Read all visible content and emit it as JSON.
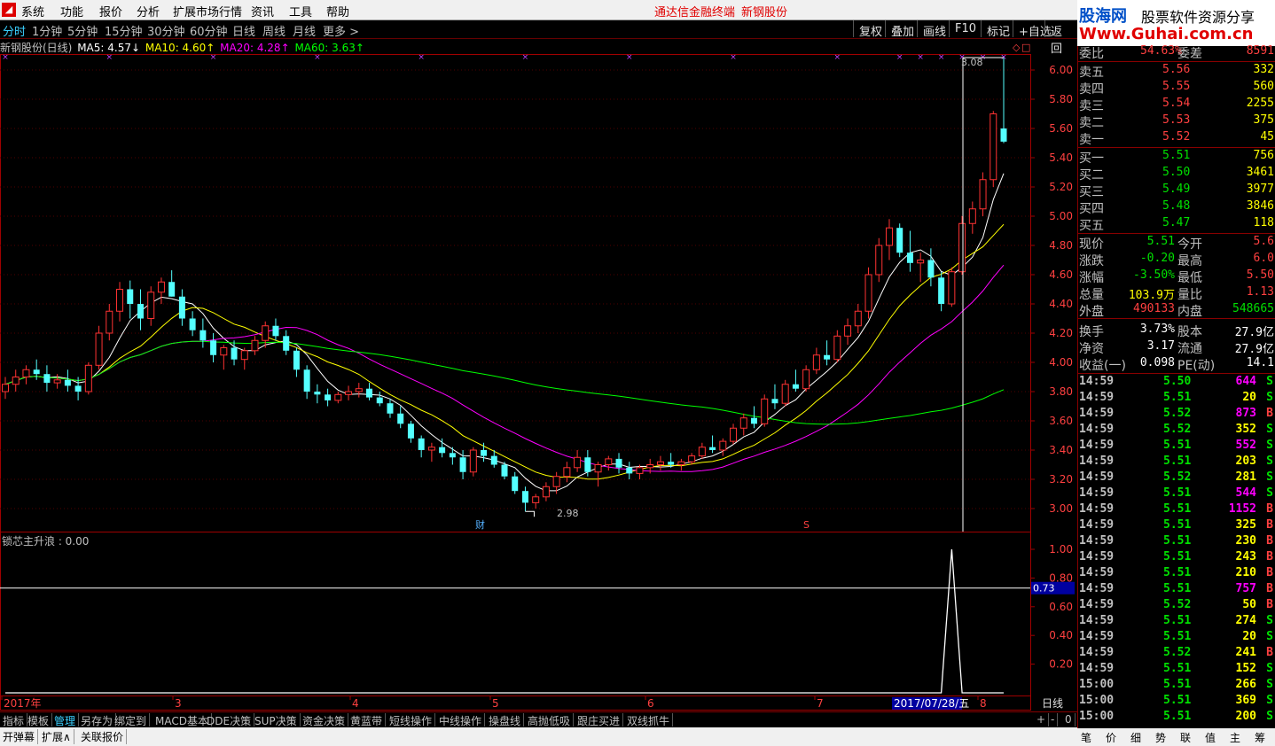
{
  "menu": {
    "items": [
      "系统",
      "功能",
      "报价",
      "分析",
      "扩展市场行情",
      "资讯",
      "工具",
      "帮助"
    ],
    "title1": "通达信金融终端",
    "title2": "新钢股份"
  },
  "brand": {
    "logo": "股海网",
    "slogan": "股票软件资源分享",
    "url": "Www.Guhai.com.cn"
  },
  "periods": [
    "分时",
    "1分钟",
    "5分钟",
    "15分钟",
    "30分钟",
    "60分钟",
    "日线",
    "周线",
    "月线",
    "更多 >"
  ],
  "right_buttons": [
    "复权",
    "叠加",
    "画线",
    "F10",
    "标记",
    "+自选",
    "返回"
  ],
  "ma": {
    "name": "新钢股份(日线)",
    "ma5": "MA5: 4.57↓",
    "ma10": "MA10: 4.60↑",
    "ma20": "MA20: 4.28↑",
    "ma60": "MA60: 3.63↑",
    "colors": {
      "ma5": "#ffffff",
      "ma10": "#ffff00",
      "ma20": "#ff00ff",
      "ma60": "#00ff00"
    }
  },
  "price_axis": [
    "6.00",
    "5.80",
    "5.60",
    "5.40",
    "5.20",
    "5.00",
    "4.80",
    "4.60",
    "4.40",
    "4.20",
    "4.00",
    "3.80",
    "3.60",
    "3.40",
    "3.20",
    "3.00"
  ],
  "ind_axis": [
    "1.00",
    "0.80",
    "0.60",
    "0.40",
    "0.20"
  ],
  "ind_current": "0.73",
  "annotations": {
    "high": "3.08",
    "low": "2.98",
    "cai": "财",
    "s": "S"
  },
  "indicator_label": "锁芯主升浪 : 0.00",
  "x_axis": {
    "year": "2017年",
    "m3": "3",
    "m4": "4",
    "m5": "5",
    "m6": "6",
    "m7": "7",
    "date": "2017/07/28/五",
    "m8": "8",
    "period": "日线"
  },
  "bottom_tabs": [
    "指标",
    "模板",
    "管理",
    "另存为",
    "绑定到",
    "MACD基本",
    "DDE决策",
    "SUP决策",
    "资金决策",
    "黄蓝带",
    "短线操作",
    "中线操作",
    "操盘线",
    "高抛低吸",
    "跟庄买进",
    "双线抓牛"
  ],
  "bottom_tabs2": [
    "开弹幕",
    "扩展∧",
    "关联报价"
  ],
  "zoom": [
    "+",
    "-",
    "0"
  ],
  "quote": {
    "wb": {
      "l1": "委比",
      "v1": "54.63%",
      "l2": "委差",
      "v2": "8591"
    },
    "sell": [
      [
        "卖五",
        "5.56",
        "332"
      ],
      [
        "卖四",
        "5.55",
        "560"
      ],
      [
        "卖三",
        "5.54",
        "2255"
      ],
      [
        "卖二",
        "5.53",
        "375"
      ],
      [
        "卖一",
        "5.52",
        "45"
      ]
    ],
    "buy": [
      [
        "买一",
        "5.51",
        "756"
      ],
      [
        "买二",
        "5.50",
        "3461"
      ],
      [
        "买三",
        "5.49",
        "3977"
      ],
      [
        "买四",
        "5.48",
        "3846"
      ],
      [
        "买五",
        "5.47",
        "118"
      ]
    ],
    "stats": [
      [
        "现价",
        "5.51",
        "今开",
        "5.6"
      ],
      [
        "涨跌",
        "-0.20",
        "最高",
        "6.0"
      ],
      [
        "涨幅",
        "-3.50%",
        "最低",
        "5.50"
      ],
      [
        "总量",
        "103.9万",
        "量比",
        "1.13"
      ],
      [
        "外盘",
        "490133",
        "内盘",
        "548665"
      ],
      [
        "换手",
        "3.73%",
        "股本",
        "27.9亿"
      ],
      [
        "净资",
        "3.17",
        "流通",
        "27.9亿"
      ],
      [
        "收益(一)",
        "0.098",
        "PE(动)",
        "14.1"
      ]
    ],
    "ticks": [
      [
        "14:59",
        "5.50",
        "644",
        "S"
      ],
      [
        "14:59",
        "5.51",
        "20",
        "S"
      ],
      [
        "14:59",
        "5.52",
        "873",
        "B"
      ],
      [
        "14:59",
        "5.52",
        "352",
        "S"
      ],
      [
        "14:59",
        "5.51",
        "552",
        "S"
      ],
      [
        "14:59",
        "5.51",
        "203",
        "S"
      ],
      [
        "14:59",
        "5.52",
        "281",
        "S"
      ],
      [
        "14:59",
        "5.51",
        "544",
        "S"
      ],
      [
        "14:59",
        "5.51",
        "1152",
        "B"
      ],
      [
        "14:59",
        "5.51",
        "325",
        "B"
      ],
      [
        "14:59",
        "5.51",
        "230",
        "B"
      ],
      [
        "14:59",
        "5.51",
        "243",
        "B"
      ],
      [
        "14:59",
        "5.51",
        "210",
        "B"
      ],
      [
        "14:59",
        "5.51",
        "757",
        "B"
      ],
      [
        "14:59",
        "5.52",
        "50",
        "B"
      ],
      [
        "14:59",
        "5.51",
        "274",
        "S"
      ],
      [
        "14:59",
        "5.51",
        "20",
        "S"
      ],
      [
        "14:59",
        "5.52",
        "241",
        "B"
      ],
      [
        "14:59",
        "5.51",
        "152",
        "S"
      ],
      [
        "15:00",
        "5.51",
        "266",
        "S"
      ],
      [
        "15:00",
        "5.51",
        "369",
        "S"
      ],
      [
        "15:00",
        "5.51",
        "200",
        "S"
      ]
    ],
    "tabs": [
      "笔",
      "价",
      "细",
      "势",
      "联",
      "值",
      "主",
      "筹"
    ]
  },
  "chart_data": {
    "type": "candlestick",
    "title": "新钢股份(日线)",
    "ylim": [
      2.9,
      6.1
    ],
    "candles": [
      [
        3.8,
        3.9,
        3.75,
        3.85
      ],
      [
        3.85,
        3.95,
        3.8,
        3.9
      ],
      [
        3.9,
        3.98,
        3.85,
        3.95
      ],
      [
        3.95,
        4.02,
        3.88,
        3.92
      ],
      [
        3.92,
        3.98,
        3.8,
        3.86
      ],
      [
        3.86,
        3.92,
        3.82,
        3.88
      ],
      [
        3.88,
        3.95,
        3.8,
        3.84
      ],
      [
        3.84,
        3.9,
        3.74,
        3.8
      ],
      [
        3.8,
        4.0,
        3.78,
        3.98
      ],
      [
        3.98,
        4.25,
        3.95,
        4.2
      ],
      [
        4.2,
        4.4,
        4.15,
        4.35
      ],
      [
        4.35,
        4.55,
        4.28,
        4.5
      ],
      [
        4.5,
        4.56,
        4.3,
        4.4
      ],
      [
        4.4,
        4.5,
        4.22,
        4.3
      ],
      [
        4.3,
        4.52,
        4.25,
        4.48
      ],
      [
        4.48,
        4.58,
        4.4,
        4.55
      ],
      [
        4.55,
        4.63,
        4.45,
        4.45
      ],
      [
        4.45,
        4.5,
        4.25,
        4.3
      ],
      [
        4.3,
        4.35,
        4.18,
        4.22
      ],
      [
        4.22,
        4.3,
        4.1,
        4.15
      ],
      [
        4.15,
        4.2,
        4.0,
        4.05
      ],
      [
        4.05,
        4.12,
        3.95,
        4.1
      ],
      [
        4.1,
        4.15,
        3.98,
        4.02
      ],
      [
        4.02,
        4.1,
        3.95,
        4.08
      ],
      [
        4.08,
        4.18,
        4.05,
        4.15
      ],
      [
        4.15,
        4.28,
        4.1,
        4.25
      ],
      [
        4.25,
        4.3,
        4.15,
        4.18
      ],
      [
        4.18,
        4.22,
        4.05,
        4.08
      ],
      [
        4.08,
        4.1,
        3.9,
        3.95
      ],
      [
        3.95,
        3.98,
        3.75,
        3.8
      ],
      [
        3.8,
        3.85,
        3.72,
        3.78
      ],
      [
        3.78,
        3.82,
        3.7,
        3.74
      ],
      [
        3.74,
        3.8,
        3.72,
        3.78
      ],
      [
        3.78,
        3.84,
        3.74,
        3.8
      ],
      [
        3.8,
        3.86,
        3.76,
        3.82
      ],
      [
        3.82,
        3.86,
        3.74,
        3.76
      ],
      [
        3.76,
        3.8,
        3.7,
        3.72
      ],
      [
        3.72,
        3.75,
        3.62,
        3.65
      ],
      [
        3.65,
        3.7,
        3.55,
        3.58
      ],
      [
        3.58,
        3.6,
        3.45,
        3.48
      ],
      [
        3.48,
        3.5,
        3.35,
        3.4
      ],
      [
        3.4,
        3.45,
        3.32,
        3.42
      ],
      [
        3.42,
        3.48,
        3.35,
        3.38
      ],
      [
        3.38,
        3.42,
        3.3,
        3.35
      ],
      [
        3.35,
        3.4,
        3.2,
        3.25
      ],
      [
        3.25,
        3.42,
        3.22,
        3.4
      ],
      [
        3.4,
        3.45,
        3.32,
        3.36
      ],
      [
        3.36,
        3.4,
        3.28,
        3.3
      ],
      [
        3.3,
        3.32,
        3.2,
        3.22
      ],
      [
        3.22,
        3.25,
        3.1,
        3.12
      ],
      [
        3.12,
        3.15,
        2.98,
        3.04
      ],
      [
        3.04,
        3.1,
        3.0,
        3.08
      ],
      [
        3.08,
        3.18,
        3.05,
        3.15
      ],
      [
        3.15,
        3.25,
        3.1,
        3.22
      ],
      [
        3.22,
        3.32,
        3.18,
        3.28
      ],
      [
        3.28,
        3.4,
        3.25,
        3.35
      ],
      [
        3.35,
        3.4,
        3.22,
        3.25
      ],
      [
        3.25,
        3.32,
        3.15,
        3.3
      ],
      [
        3.3,
        3.36,
        3.26,
        3.34
      ],
      [
        3.34,
        3.38,
        3.24,
        3.28
      ],
      [
        3.28,
        3.32,
        3.2,
        3.24
      ],
      [
        3.24,
        3.3,
        3.2,
        3.28
      ],
      [
        3.28,
        3.34,
        3.24,
        3.3
      ],
      [
        3.3,
        3.36,
        3.26,
        3.32
      ],
      [
        3.32,
        3.38,
        3.28,
        3.3
      ],
      [
        3.3,
        3.34,
        3.26,
        3.32
      ],
      [
        3.32,
        3.38,
        3.3,
        3.36
      ],
      [
        3.36,
        3.45,
        3.34,
        3.42
      ],
      [
        3.42,
        3.5,
        3.38,
        3.4
      ],
      [
        3.4,
        3.48,
        3.36,
        3.46
      ],
      [
        3.46,
        3.58,
        3.44,
        3.55
      ],
      [
        3.55,
        3.65,
        3.5,
        3.62
      ],
      [
        3.62,
        3.7,
        3.55,
        3.58
      ],
      [
        3.58,
        3.78,
        3.56,
        3.75
      ],
      [
        3.75,
        3.85,
        3.68,
        3.72
      ],
      [
        3.72,
        3.88,
        3.7,
        3.85
      ],
      [
        3.85,
        3.95,
        3.8,
        3.82
      ],
      [
        3.82,
        3.98,
        3.8,
        3.95
      ],
      [
        3.95,
        4.1,
        3.92,
        4.05
      ],
      [
        4.05,
        4.15,
        3.98,
        4.02
      ],
      [
        4.02,
        4.22,
        4.0,
        4.18
      ],
      [
        4.18,
        4.3,
        4.12,
        4.25
      ],
      [
        4.25,
        4.4,
        4.2,
        4.35
      ],
      [
        4.35,
        4.65,
        4.3,
        4.6
      ],
      [
        4.6,
        4.85,
        4.55,
        4.8
      ],
      [
        4.8,
        4.98,
        4.7,
        4.92
      ],
      [
        4.92,
        4.95,
        4.72,
        4.75
      ],
      [
        4.75,
        4.9,
        4.62,
        4.68
      ],
      [
        4.68,
        4.75,
        4.55,
        4.7
      ],
      [
        4.7,
        4.78,
        4.52,
        4.58
      ],
      [
        4.58,
        4.62,
        4.35,
        4.4
      ],
      [
        4.4,
        4.65,
        4.38,
        4.62
      ],
      [
        4.62,
        5.0,
        4.6,
        4.95
      ],
      [
        4.95,
        5.1,
        4.88,
        5.05
      ],
      [
        5.05,
        5.3,
        5.0,
        5.25
      ],
      [
        5.25,
        5.72,
        5.2,
        5.7
      ],
      [
        5.6,
        6.09,
        5.5,
        5.51
      ]
    ],
    "indicator": {
      "name": "锁芯主升浪",
      "value": 0.0,
      "ylim": [
        0,
        1.1
      ],
      "spikes": [
        [
          91,
          1.0
        ],
        [
          101,
          1.0
        ],
        [
          102,
          1.0
        ]
      ]
    }
  }
}
